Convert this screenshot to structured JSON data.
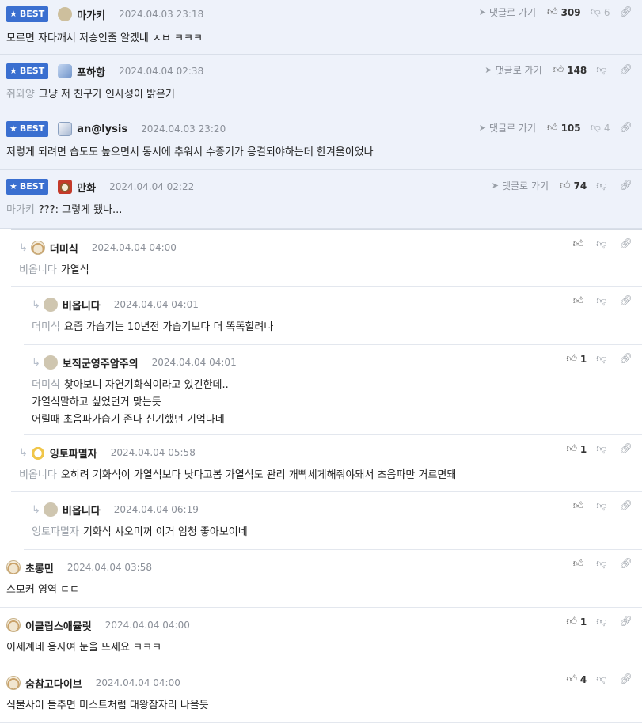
{
  "labels": {
    "best": "BEST",
    "goto_reply": "댓글로 가기"
  },
  "comments": [
    {
      "nick": "마가키",
      "date": "2024.04.03 23:18",
      "mention": "",
      "text": "모르면 자다깨서 저승인줄 알겠네 ㅅㅂ ㅋㅋㅋ",
      "up": "309",
      "down": "6"
    },
    {
      "nick": "포하항",
      "date": "2024.04.04 02:38",
      "mention": "쥐와양",
      "text": "그냥 저 친구가 인사성이 밝은거",
      "up": "148",
      "down": ""
    },
    {
      "nick": "an@lysis",
      "date": "2024.04.03 23:20",
      "mention": "",
      "text": "저렇게 되려면 습도도 높으면서 동시에 추워서 수증기가 응결되야하는데 한겨울이었나",
      "up": "105",
      "down": "4"
    },
    {
      "nick": "만화",
      "date": "2024.04.04 02:22",
      "mention": "마가키",
      "text": "???: 그렇게 됐나...",
      "up": "74",
      "down": ""
    },
    {
      "nick": "더미식",
      "date": "2024.04.04 04:00",
      "mention": "비옵니다",
      "text": "가열식",
      "up": "",
      "down": ""
    },
    {
      "nick": "비옵니다",
      "date": "2024.04.04 04:01",
      "mention": "더미식",
      "text": "요즘 가습기는 10년전 가습기보다 더 똑똑할려나",
      "up": "",
      "down": ""
    },
    {
      "nick": "보직군영주암주의",
      "date": "2024.04.04 04:01",
      "mention": "더미식",
      "lines": [
        "찾아보니 자연기화식이라고 있긴한데..",
        "가열식말하고 싶었던거 맞는듯",
        "어릴때 초음파가습기 존나 신기했던 기억나네"
      ],
      "up": "1",
      "down": ""
    },
    {
      "nick": "잉토파멸자",
      "date": "2024.04.04 05:58",
      "mention": "비옵니다",
      "text": "오히려 기화식이 가열식보다 낫다고봄 가열식도 관리 개빡세게해줘야돼서 초음파만 거르면돼",
      "up": "1",
      "down": ""
    },
    {
      "nick": "비옵니다",
      "date": "2024.04.04 06:19",
      "mention": "잉토파멸자",
      "text": "기화식 샤오미꺼 이거 엄청 좋아보이네",
      "up": "",
      "down": ""
    },
    {
      "nick": "초롱민",
      "date": "2024.04.04 03:58",
      "mention": "",
      "text": "스모커 영역 ㄷㄷ",
      "up": "",
      "down": ""
    },
    {
      "nick": "이클립스애뮬릿",
      "date": "2024.04.04 04:00",
      "mention": "",
      "text": "이세계네 용사여 눈을 뜨세요 ㅋㅋㅋ",
      "up": "1",
      "down": ""
    },
    {
      "nick": "숨참고다이브",
      "date": "2024.04.04 04:00",
      "mention": "",
      "text": "식물사이 들추면 미스트처럼 대왕잠자리 나올듯",
      "up": "4",
      "down": ""
    }
  ]
}
